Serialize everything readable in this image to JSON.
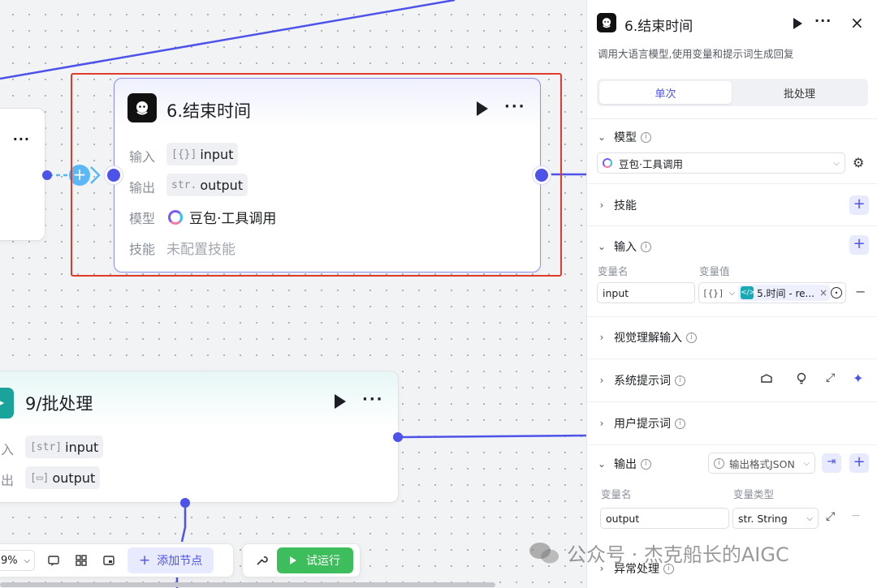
{
  "canvas": {
    "left_node": {
      "more": "···"
    },
    "main_node": {
      "title": "6.结束时间",
      "more": "···",
      "rows": [
        {
          "label": "输入",
          "type_icon": "[{}]",
          "value": "input"
        },
        {
          "label": "输出",
          "type_icon": "str.",
          "value": "output"
        },
        {
          "label": "模型",
          "value": "豆包·工具调用"
        },
        {
          "label": "技能",
          "value": "未配置技能"
        }
      ]
    },
    "batch_node": {
      "title": "9/批处理",
      "more": "···",
      "rows": [
        {
          "label": "入",
          "type_icon": "[str]",
          "value": "input"
        },
        {
          "label": "出",
          "type_icon": "[▭]",
          "value": "output"
        }
      ]
    },
    "toolbar": {
      "zoom": "9%",
      "add_node": "添加节点",
      "try_run": "试运行"
    }
  },
  "watermark": "公众号 · 杰克船长的AIGC",
  "panel": {
    "title": "6.结束时间",
    "description": "调用大语言模型,使用变量和提示词生成回复",
    "tabs": [
      "单次",
      "批处理"
    ],
    "sections": {
      "model": {
        "label": "模型",
        "value": "豆包·工具调用"
      },
      "skills": {
        "label": "技能"
      },
      "input": {
        "label": "输入",
        "col_name": "变量名",
        "col_value": "变量值",
        "var_name": "input",
        "type_icon": "[{}]",
        "ref": "5.时间 - re..."
      },
      "vision": {
        "label": "视觉理解输入"
      },
      "system_prompt": {
        "label": "系统提示词"
      },
      "user_prompt": {
        "label": "用户提示词"
      },
      "output": {
        "label": "输出",
        "format": "输出格式JSON",
        "col_name": "变量名",
        "col_type": "变量类型",
        "var_name": "output",
        "var_type": "str. String"
      },
      "exception": {
        "label": "异常处理"
      }
    },
    "colors": {
      "accent": "#4d53e8",
      "highlight": "#e13b2b",
      "run_green": "#3ebd5c"
    }
  }
}
